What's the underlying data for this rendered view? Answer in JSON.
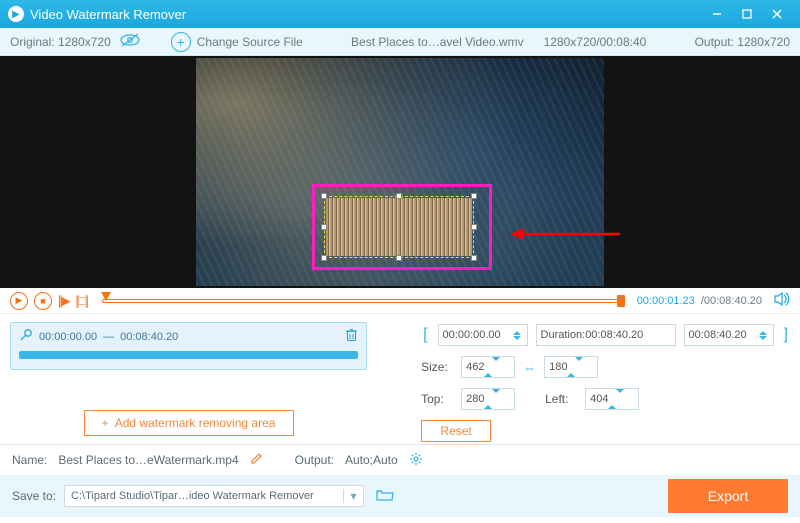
{
  "titlebar": {
    "app_title": "Video Watermark Remover"
  },
  "subheader": {
    "original_label": "Original:",
    "original_value": "1280x720",
    "change_label": "Change Source File",
    "filename": "Best Places to…avel Video.wmv",
    "file_meta": "1280x720/00:08:40",
    "output_label": "Output:",
    "output_value": "1280x720"
  },
  "player": {
    "current_time": "00:00:01.23",
    "total_time": "00:08:40.20"
  },
  "segment": {
    "start": "00:00:00.00",
    "dash": "—",
    "end": "00:08:40.20",
    "add_label": "Add watermark removing area"
  },
  "region": {
    "range_start": "00:00:00.00",
    "duration_label": "Duration:",
    "duration_value": "00:08:40.20",
    "range_end": "00:08:40.20",
    "size_label": "Size:",
    "size_w": "462",
    "size_h": "180",
    "top_label": "Top:",
    "top_value": "280",
    "left_label": "Left:",
    "left_value": "404",
    "reset_label": "Reset"
  },
  "bottom": {
    "name_label": "Name:",
    "name_value": "Best Places to…eWatermark.mp4",
    "output_label": "Output:",
    "output_value": "Auto;Auto",
    "saveto_label": "Save to:",
    "saveto_path": "C:\\Tipard Studio\\Tipar…ideo Watermark Remover",
    "export_label": "Export"
  }
}
